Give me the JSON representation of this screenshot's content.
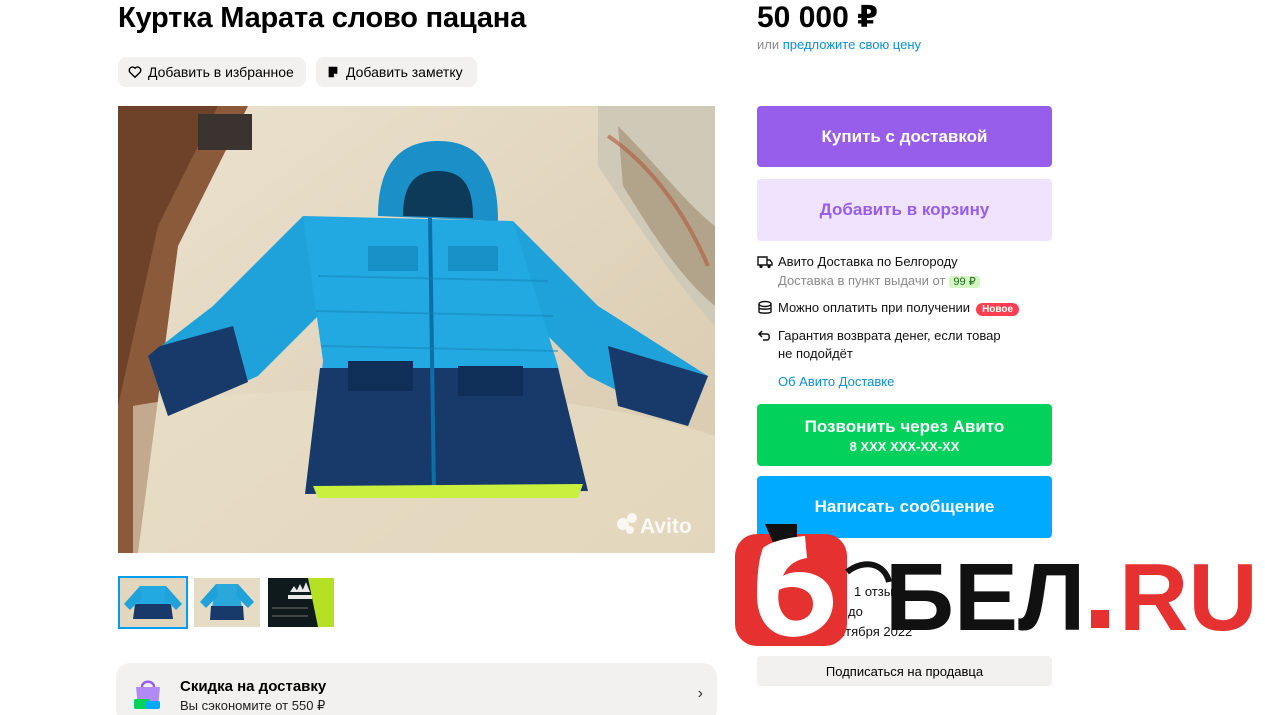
{
  "listing": {
    "title": "Куртка Марата слово пацана",
    "favorite_label": "Добавить в избранное",
    "note_label": "Добавить заметку"
  },
  "gallery": {
    "watermark": "Avito",
    "thumbnail_count": 3
  },
  "promo": {
    "title": "Скидка на доставку",
    "subtitle": "Вы сэкономите от 550 ₽",
    "chevron": "›"
  },
  "pricing": {
    "price": "50 000 ₽",
    "offer_prefix": "или",
    "offer_link": "предложите свою цену"
  },
  "actions": {
    "buy_label": "Купить с доставкой",
    "cart_label": "Добавить в корзину",
    "call_label": "Позвонить через Авито",
    "call_number": "8 XXX XXX-XX-XX",
    "message_label": "Написать сообщение",
    "subscribe_label": "Подписаться на продавца"
  },
  "delivery": {
    "line1": "Авито Доставка по Белгороду",
    "line2": "Доставка в пункт выдачи от",
    "line2_price": "99 ₽",
    "pay_on_receipt": "Можно оплатить при получении",
    "new_badge": "Новое",
    "guarantee_line1": "Гарантия возврата денег, если товар",
    "guarantee_line2": "не подойдёт",
    "about_link": "Об Авито Доставке"
  },
  "seller": {
    "reviews": "1 отзы",
    "line2": "до",
    "since": "нтября 2022"
  },
  "overlay": {
    "logo_text": "БЕЛ.RU",
    "brand_color": "#e5312f"
  },
  "colors": {
    "buy": "#965eeb",
    "cart_bg": "#efe3fd",
    "call": "#02d15c",
    "message": "#00aaff",
    "link": "#0a8fd8"
  }
}
